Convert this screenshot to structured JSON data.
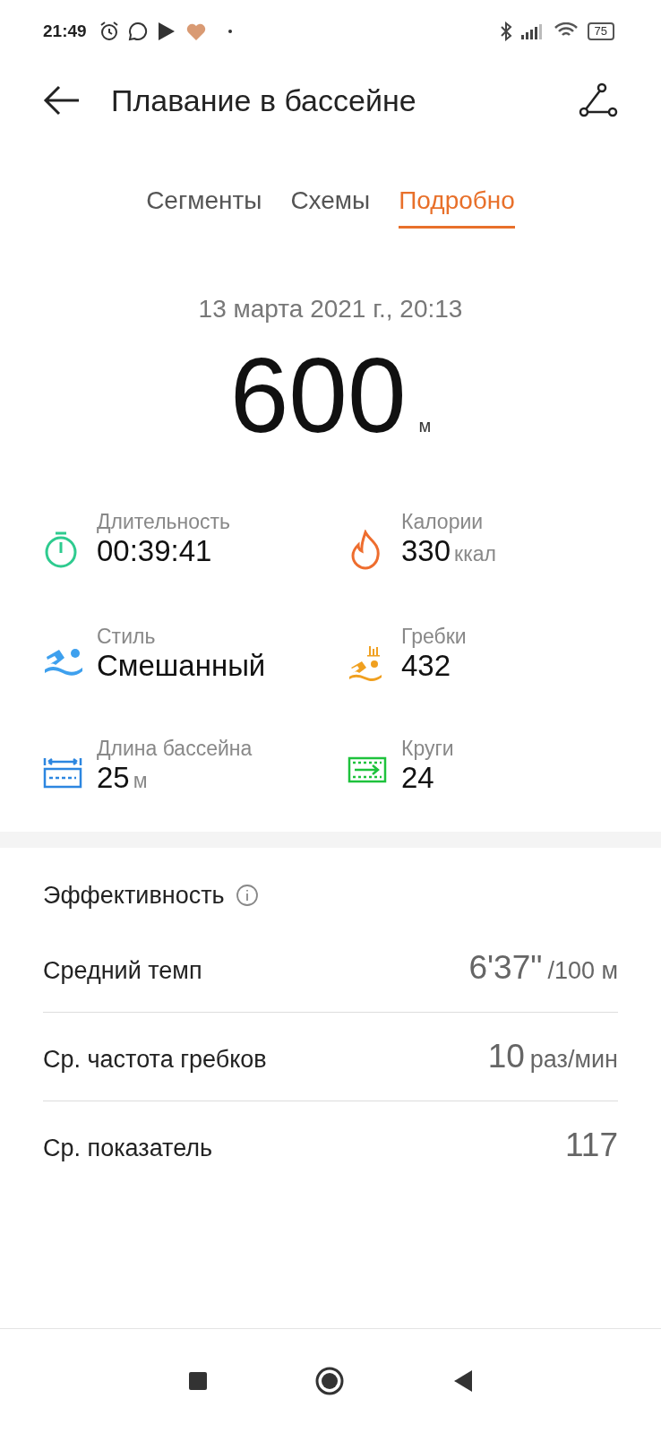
{
  "status_bar": {
    "time": "21:49",
    "battery": "75"
  },
  "header": {
    "title": "Плавание в бассейне"
  },
  "tabs": [
    {
      "label": "Сегменты",
      "selected": false
    },
    {
      "label": "Схемы",
      "selected": false
    },
    {
      "label": "Подробно",
      "selected": true
    }
  ],
  "summary": {
    "date": "13 марта 2021 г., 20:13",
    "distance": "600",
    "unit": "м"
  },
  "stats": [
    {
      "kind": "stopwatch",
      "label": "Длительность",
      "value": "00:39:41"
    },
    {
      "kind": "flame",
      "label": "Калории",
      "value": "330",
      "unit": "ккал"
    },
    {
      "kind": "swimmer",
      "label": "Стиль",
      "value": "Смешанный"
    },
    {
      "kind": "strokes",
      "label": "Гребки",
      "value": "432"
    },
    {
      "kind": "pool",
      "label": "Длина бассейна",
      "value": "25",
      "unit": "м"
    },
    {
      "kind": "laps",
      "label": "Круги",
      "value": "24"
    }
  ],
  "efficiency": {
    "title": "Эффективность",
    "rows": [
      {
        "label": "Средний темп",
        "value": "6'37\"",
        "unit": "/100 м"
      },
      {
        "label": "Ср. частота гребков",
        "value": "10",
        "unit": "раз/мин"
      },
      {
        "label": "Ср. показатель",
        "value": "117"
      }
    ]
  }
}
